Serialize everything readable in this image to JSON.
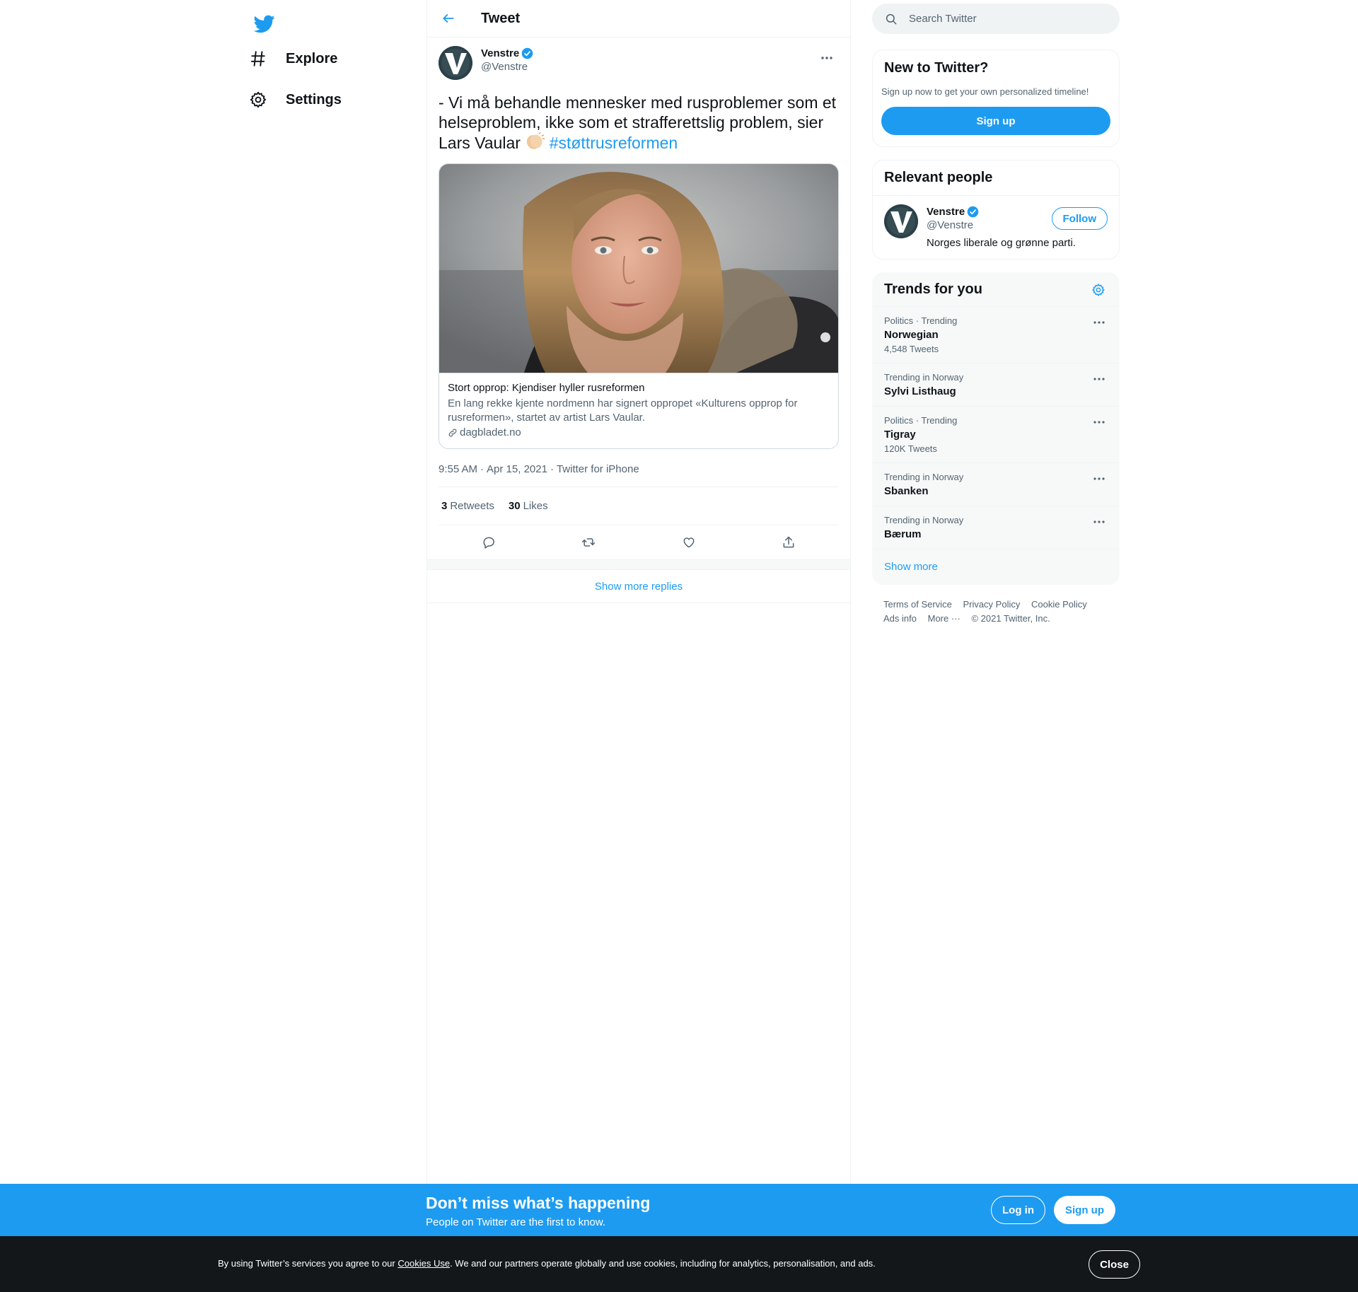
{
  "nav": {
    "logo_icon": "twitter-bird-icon",
    "items": [
      {
        "label": "Explore",
        "icon": "hashtag-icon"
      },
      {
        "label": "Settings",
        "icon": "gear-icon"
      }
    ]
  },
  "header": {
    "title": "Tweet",
    "back_icon": "arrow-left-icon"
  },
  "tweet": {
    "author_name": "Venstre",
    "author_handle": "@Venstre",
    "text_before": "- Vi må behandle mennesker med rusproblemer som et helseproblem, ikke som et strafferettslig problem, sier Lars Vaular ",
    "emoji": "👏",
    "hashtag": "#støttrusreformen",
    "card": {
      "title": "Stort opprop: Kjendiser hyller rusreformen",
      "description": "En lang rekke kjente nordmenn har signert oppropet «Kulturens opprop for rusreformen», startet av artist Lars Vaular.",
      "domain": "dagbladet.no"
    },
    "time": "9:55 AM",
    "date": "Apr 15, 2021",
    "source": "Twitter for iPhone",
    "separator": "·",
    "retweets_count": "3",
    "retweets_label": "Retweets",
    "likes_count": "30",
    "likes_label": "Likes",
    "actions": [
      "reply-icon",
      "retweet-icon",
      "like-icon",
      "share-icon"
    ]
  },
  "show_more_replies": "Show more replies",
  "sidebar": {
    "search_placeholder": "Search Twitter",
    "new_to_twitter": {
      "title": "New to Twitter?",
      "subtitle": "Sign up now to get your own personalized timeline!",
      "button": "Sign up"
    },
    "relevant_people": {
      "title": "Relevant people",
      "person": {
        "name": "Venstre",
        "handle": "@Venstre",
        "bio": "Norges liberale og grønne parti.",
        "follow": "Follow"
      }
    },
    "trends": {
      "title": "Trends for you",
      "items": [
        {
          "category": "Politics · Trending",
          "name": "Norwegian",
          "count": "4,548 Tweets"
        },
        {
          "category": "Trending in Norway",
          "name": "Sylvi Listhaug",
          "count": ""
        },
        {
          "category": "Politics · Trending",
          "name": "Tigray",
          "count": "120K Tweets"
        },
        {
          "category": "Trending in Norway",
          "name": "Sbanken",
          "count": ""
        },
        {
          "category": "Trending in Norway",
          "name": "Bærum",
          "count": ""
        }
      ],
      "show_more": "Show more"
    },
    "footer": {
      "terms": "Terms of Service",
      "privacy": "Privacy Policy",
      "cookie": "Cookie Policy",
      "ads": "Ads info",
      "more": "More ···",
      "copyright": "© 2021 Twitter, Inc."
    }
  },
  "banner": {
    "title": "Don’t miss what’s happening",
    "subtitle": "People on Twitter are the first to know.",
    "login": "Log in",
    "signup": "Sign up"
  },
  "cookie_bar": {
    "text_before": "By using Twitter’s services you agree to our ",
    "link": "Cookies Use",
    "text_after": ". We and our partners operate globally and use cookies, including for analytics, personalisation, and ads.",
    "close": "Close"
  },
  "colors": {
    "accent": "#1d9bf0",
    "text": "#0f1419",
    "secondary": "#536471",
    "cookie_bg": "#14171a"
  }
}
